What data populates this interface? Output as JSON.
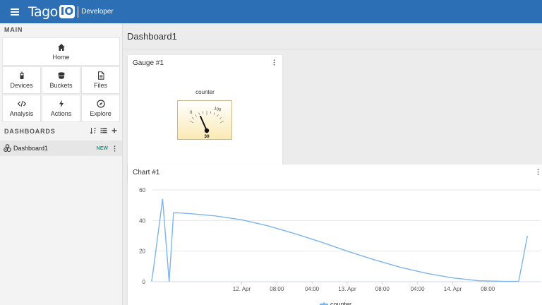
{
  "header": {
    "logo_text": "Tago",
    "logo_box": "IO",
    "subtitle": "Developer"
  },
  "sidebar": {
    "main_title": "MAIN",
    "tiles": [
      {
        "label": "Home",
        "icon": "home-icon"
      },
      {
        "label": "Devices",
        "icon": "device-icon"
      },
      {
        "label": "Buckets",
        "icon": "bucket-icon"
      },
      {
        "label": "Files",
        "icon": "file-icon"
      },
      {
        "label": "Analysis",
        "icon": "code-icon"
      },
      {
        "label": "Actions",
        "icon": "bolt-icon"
      },
      {
        "label": "Explore",
        "icon": "compass-icon"
      }
    ],
    "dashboards_title": "DASHBOARDS",
    "dashboards": [
      {
        "name": "Dashboard1",
        "badge": "NEW"
      }
    ]
  },
  "page": {
    "title": "Dashboard1"
  },
  "gauge_widget": {
    "title": "Gauge #1",
    "variable": "counter",
    "value": 30,
    "scale_min": 0,
    "scale_max": 100,
    "min_label": "0",
    "max_label": "100",
    "value_label": "30"
  },
  "chart_widget": {
    "title": "Chart #1",
    "legend": "counter"
  },
  "chart_data": {
    "type": "line",
    "title": "Chart #1",
    "xlabel": "",
    "ylabel": "",
    "ylim": [
      0,
      60
    ],
    "y_ticks": [
      "0",
      "20",
      "40",
      "60"
    ],
    "x_ticks": [
      "12. Apr",
      "08:00",
      "04:00",
      "13. Apr",
      "08:00",
      "04:00",
      "14. Apr",
      "08:00"
    ],
    "grid": true,
    "legend_position": "bottom",
    "series": [
      {
        "name": "counter",
        "color": "#7cb5ec",
        "x": [
          "11. Apr 03:30",
          "11. Apr 04:00",
          "11. Apr 06:00",
          "11. Apr 07:30",
          "11. Apr 08:30",
          "11. Apr 09:30",
          "11. Apr 12:00",
          "11. Apr 18:00",
          "12. Apr 00:00",
          "12. Apr 06:00",
          "12. Apr 12:00",
          "12. Apr 18:00",
          "13. Apr 00:00",
          "13. Apr 06:00",
          "13. Apr 12:00",
          "13. Apr 18:00",
          "14. Apr 00:00",
          "14. Apr 06:00",
          "14. Apr 12:00",
          "14. Apr 15:00",
          "14. Apr 16:00",
          "14. Apr 17:00"
        ],
        "y": [
          0,
          10,
          54,
          0,
          45,
          45,
          44.6,
          43,
          40.5,
          36.5,
          31.5,
          26,
          20,
          14.5,
          9.5,
          5.5,
          2.5,
          0.6,
          0.2,
          0.2,
          15,
          30
        ]
      }
    ]
  }
}
